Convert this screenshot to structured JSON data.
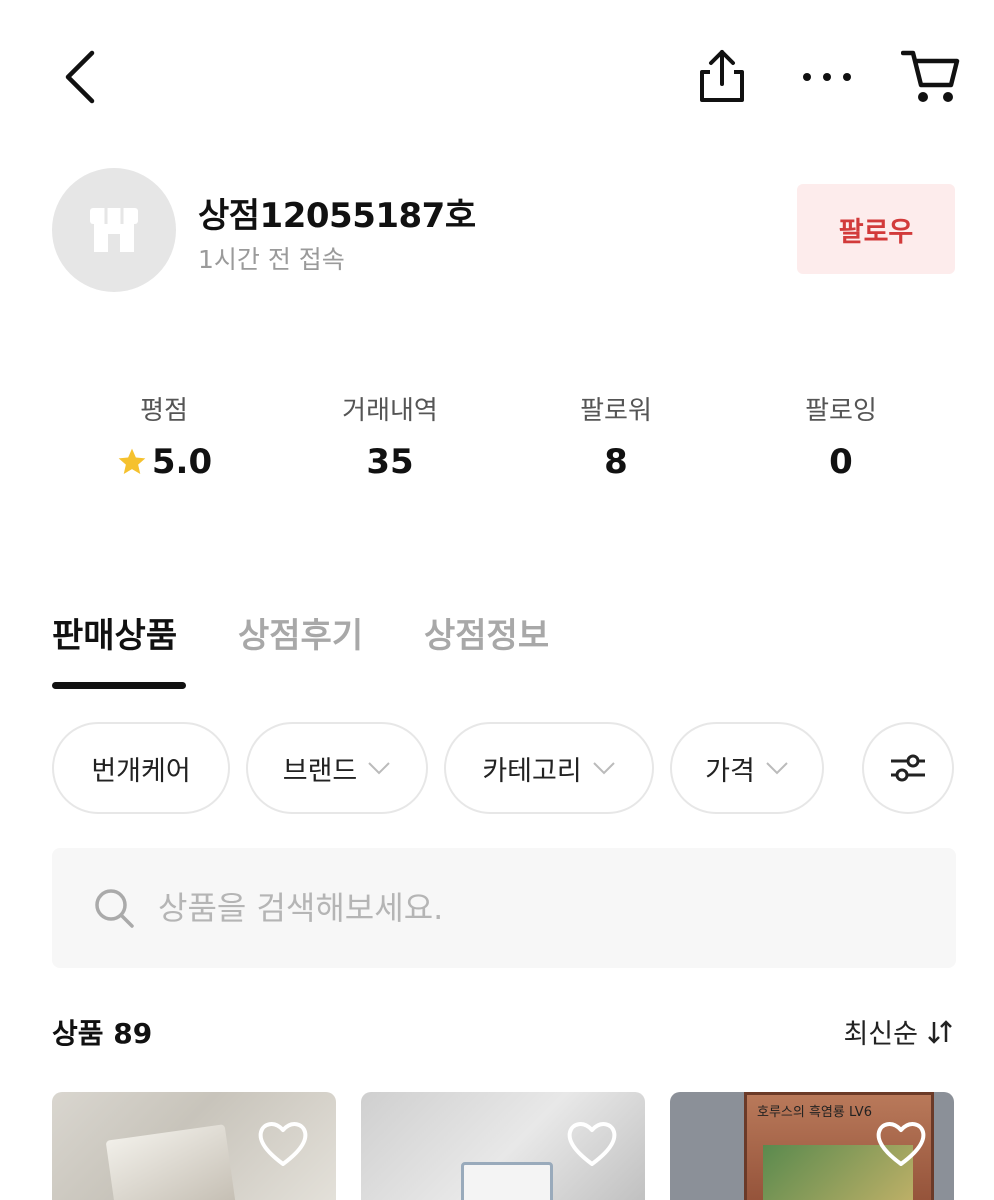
{
  "header": {
    "back_icon": "chevron-left-icon",
    "share_icon": "share-icon",
    "more_icon": "more-horizontal-icon",
    "cart_icon": "cart-icon"
  },
  "shop": {
    "name": "상점12055187호",
    "last_access": "1시간 전 접속",
    "avatar_icon": "store-icon",
    "follow_label": "팔로우",
    "follow_color": "#d23a3a",
    "follow_bg": "#fdecec"
  },
  "stats": [
    {
      "label": "평점",
      "value": "5.0",
      "icon": "star-icon"
    },
    {
      "label": "거래내역",
      "value": "35"
    },
    {
      "label": "팔로워",
      "value": "8"
    },
    {
      "label": "팔로잉",
      "value": "0"
    }
  ],
  "tabs": [
    {
      "label": "판매상품",
      "active": true
    },
    {
      "label": "상점후기",
      "active": false
    },
    {
      "label": "상점정보",
      "active": false
    }
  ],
  "filters": [
    {
      "label": "번개케어"
    },
    {
      "label": "브랜드",
      "icon": "chevron-down-icon"
    },
    {
      "label": "카테고리",
      "icon": "chevron-down-icon"
    },
    {
      "label": "가격",
      "icon": "chevron-down-icon"
    }
  ],
  "filter_settings_icon": "sliders-icon",
  "search": {
    "placeholder": "상품을 검색해보세요.",
    "value": "",
    "icon": "search-icon"
  },
  "products": {
    "count_label": "상품 89",
    "sort_label": "최신순",
    "sort_icon": "sort-arrows-icon",
    "items": [
      {
        "heart_icon": "heart-icon"
      },
      {
        "heart_icon": "heart-icon"
      },
      {
        "heart_icon": "heart-icon",
        "card_text": "호루스의 흑염룡 LV6"
      }
    ]
  }
}
